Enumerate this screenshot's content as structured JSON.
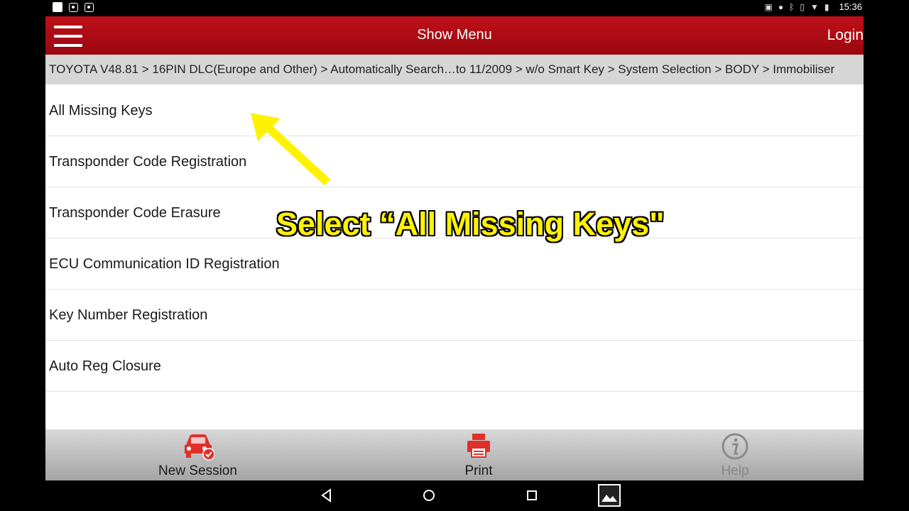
{
  "status_bar": {
    "left_icons": [
      "notification-square-icon",
      "screenshot-icon",
      "screenshot-icon"
    ],
    "right_icons": [
      "cast-icon",
      "location-icon",
      "bluetooth-icon",
      "vibrate-icon",
      "wifi-icon",
      "battery-icon"
    ],
    "time": "15:36"
  },
  "header": {
    "title": "Show Menu",
    "login_label": "Login",
    "color": "#b00d15"
  },
  "breadcrumb": "TOYOTA V48.81 > 16PIN DLC(Europe and Other) > Automatically Search…to 11/2009 > w/o Smart Key > System Selection > BODY > Immobiliser",
  "menu_items": [
    "All Missing Keys",
    "Transponder Code Registration",
    "Transponder Code Erasure",
    "ECU Communication ID Registration",
    "Key Number Registration",
    "Auto Reg Closure"
  ],
  "annotation": {
    "text": "Select “All Missing Keys\"",
    "color": "#fff200"
  },
  "bottom_bar": {
    "new_session": "New Session",
    "print": "Print",
    "help": "Help"
  },
  "nav_bar": [
    "back-icon",
    "home-icon",
    "recents-icon",
    "gallery-icon"
  ]
}
